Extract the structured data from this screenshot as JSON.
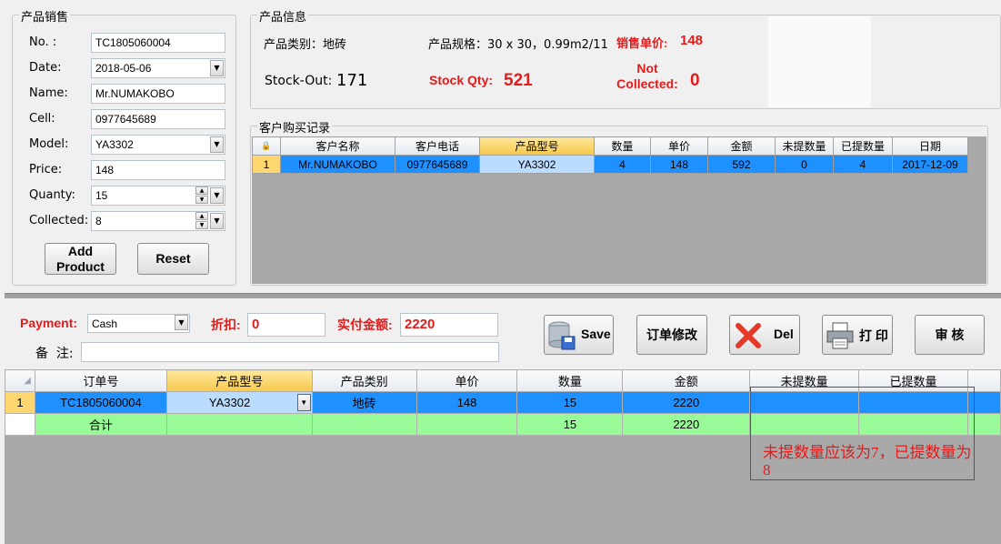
{
  "sales": {
    "group_title": "产品销售",
    "no_label": "No. :",
    "no_value": "TC1805060004",
    "date_label": "Date:",
    "date_value": "2018-05-06",
    "name_label": "Name:",
    "name_value": "Mr.NUMAKOBO",
    "cell_label": "Cell:",
    "cell_value": "0977645689",
    "model_label": "Model:",
    "model_value": "YA3302",
    "price_label": "Price:",
    "price_value": "148",
    "qty_label": "Quanty:",
    "qty_value": "15",
    "collected_label": "Collected:",
    "collected_value": "8",
    "add_line1": "Add",
    "add_line2": "Product",
    "reset_label": "Reset"
  },
  "product_info": {
    "group_title": "产品信息",
    "category_text": "产品类别：地砖",
    "spec_text": "产品规格：30 x 30，0.99m2/11",
    "price_label": "销售单价:",
    "price_value": "148",
    "stockout_label": "Stock-Out:",
    "stockout_value": "171",
    "stockqty_label": "Stock Qty:",
    "stockqty_value": "521",
    "notcollected_line1": "Not",
    "notcollected_line2": "Collected:",
    "notcollected_value": "0"
  },
  "history": {
    "group_title": "客户购买记录",
    "headers": [
      "客户名称",
      "客户电话",
      "产品型号",
      "数量",
      "单价",
      "金额",
      "未提数量",
      "已提数量",
      "日期"
    ],
    "row": {
      "index": "1",
      "cells": [
        "Mr.NUMAKOBO",
        "0977645689",
        "YA3302",
        "4",
        "148",
        "592",
        "0",
        "4",
        "2017-12-09"
      ]
    }
  },
  "payment": {
    "payment_label": "Payment:",
    "payment_value": "Cash",
    "discount_label": "折扣:",
    "discount_value": "0",
    "actual_label": "实付金额:",
    "actual_value": "2220",
    "remark_label": "备  注:",
    "remark_value": ""
  },
  "actions": {
    "save": "Save",
    "modify": "订单修改",
    "del": "Del",
    "print": "打 印",
    "audit": "审 核"
  },
  "order_grid": {
    "headers": [
      "订单号",
      "产品型号",
      "产品类别",
      "单价",
      "数量",
      "金额",
      "未提数量",
      "已提数量"
    ],
    "row1": {
      "index": "1",
      "cells": [
        "TC1805060004",
        "YA3302",
        "地砖",
        "148",
        "15",
        "2220",
        "",
        ""
      ]
    },
    "total_row": {
      "cells": [
        "合计",
        "",
        "",
        "",
        "15",
        "2220",
        "",
        ""
      ]
    }
  },
  "annotation": {
    "text_line1": "未提数量应该为7，已提数量为",
    "text_line2": "8",
    "color": "#e31b1b"
  }
}
